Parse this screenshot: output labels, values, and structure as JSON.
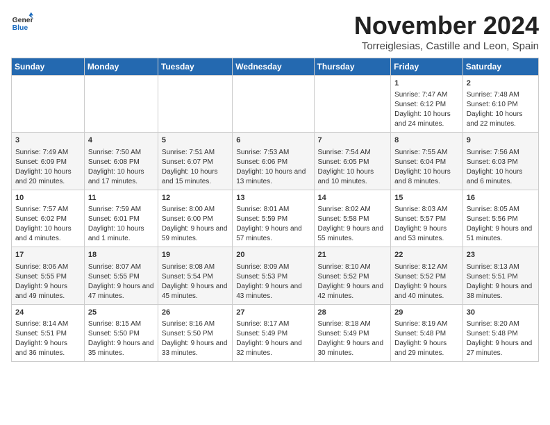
{
  "header": {
    "logo_line1": "General",
    "logo_line2": "Blue",
    "month": "November 2024",
    "location": "Torreiglesias, Castille and Leon, Spain"
  },
  "days_of_week": [
    "Sunday",
    "Monday",
    "Tuesday",
    "Wednesday",
    "Thursday",
    "Friday",
    "Saturday"
  ],
  "weeks": [
    [
      {
        "day": "",
        "data": ""
      },
      {
        "day": "",
        "data": ""
      },
      {
        "day": "",
        "data": ""
      },
      {
        "day": "",
        "data": ""
      },
      {
        "day": "",
        "data": ""
      },
      {
        "day": "1",
        "data": "Sunrise: 7:47 AM\nSunset: 6:12 PM\nDaylight: 10 hours and 24 minutes."
      },
      {
        "day": "2",
        "data": "Sunrise: 7:48 AM\nSunset: 6:10 PM\nDaylight: 10 hours and 22 minutes."
      }
    ],
    [
      {
        "day": "3",
        "data": "Sunrise: 7:49 AM\nSunset: 6:09 PM\nDaylight: 10 hours and 20 minutes."
      },
      {
        "day": "4",
        "data": "Sunrise: 7:50 AM\nSunset: 6:08 PM\nDaylight: 10 hours and 17 minutes."
      },
      {
        "day": "5",
        "data": "Sunrise: 7:51 AM\nSunset: 6:07 PM\nDaylight: 10 hours and 15 minutes."
      },
      {
        "day": "6",
        "data": "Sunrise: 7:53 AM\nSunset: 6:06 PM\nDaylight: 10 hours and 13 minutes."
      },
      {
        "day": "7",
        "data": "Sunrise: 7:54 AM\nSunset: 6:05 PM\nDaylight: 10 hours and 10 minutes."
      },
      {
        "day": "8",
        "data": "Sunrise: 7:55 AM\nSunset: 6:04 PM\nDaylight: 10 hours and 8 minutes."
      },
      {
        "day": "9",
        "data": "Sunrise: 7:56 AM\nSunset: 6:03 PM\nDaylight: 10 hours and 6 minutes."
      }
    ],
    [
      {
        "day": "10",
        "data": "Sunrise: 7:57 AM\nSunset: 6:02 PM\nDaylight: 10 hours and 4 minutes."
      },
      {
        "day": "11",
        "data": "Sunrise: 7:59 AM\nSunset: 6:01 PM\nDaylight: 10 hours and 1 minute."
      },
      {
        "day": "12",
        "data": "Sunrise: 8:00 AM\nSunset: 6:00 PM\nDaylight: 9 hours and 59 minutes."
      },
      {
        "day": "13",
        "data": "Sunrise: 8:01 AM\nSunset: 5:59 PM\nDaylight: 9 hours and 57 minutes."
      },
      {
        "day": "14",
        "data": "Sunrise: 8:02 AM\nSunset: 5:58 PM\nDaylight: 9 hours and 55 minutes."
      },
      {
        "day": "15",
        "data": "Sunrise: 8:03 AM\nSunset: 5:57 PM\nDaylight: 9 hours and 53 minutes."
      },
      {
        "day": "16",
        "data": "Sunrise: 8:05 AM\nSunset: 5:56 PM\nDaylight: 9 hours and 51 minutes."
      }
    ],
    [
      {
        "day": "17",
        "data": "Sunrise: 8:06 AM\nSunset: 5:55 PM\nDaylight: 9 hours and 49 minutes."
      },
      {
        "day": "18",
        "data": "Sunrise: 8:07 AM\nSunset: 5:55 PM\nDaylight: 9 hours and 47 minutes."
      },
      {
        "day": "19",
        "data": "Sunrise: 8:08 AM\nSunset: 5:54 PM\nDaylight: 9 hours and 45 minutes."
      },
      {
        "day": "20",
        "data": "Sunrise: 8:09 AM\nSunset: 5:53 PM\nDaylight: 9 hours and 43 minutes."
      },
      {
        "day": "21",
        "data": "Sunrise: 8:10 AM\nSunset: 5:52 PM\nDaylight: 9 hours and 42 minutes."
      },
      {
        "day": "22",
        "data": "Sunrise: 8:12 AM\nSunset: 5:52 PM\nDaylight: 9 hours and 40 minutes."
      },
      {
        "day": "23",
        "data": "Sunrise: 8:13 AM\nSunset: 5:51 PM\nDaylight: 9 hours and 38 minutes."
      }
    ],
    [
      {
        "day": "24",
        "data": "Sunrise: 8:14 AM\nSunset: 5:51 PM\nDaylight: 9 hours and 36 minutes."
      },
      {
        "day": "25",
        "data": "Sunrise: 8:15 AM\nSunset: 5:50 PM\nDaylight: 9 hours and 35 minutes."
      },
      {
        "day": "26",
        "data": "Sunrise: 8:16 AM\nSunset: 5:50 PM\nDaylight: 9 hours and 33 minutes."
      },
      {
        "day": "27",
        "data": "Sunrise: 8:17 AM\nSunset: 5:49 PM\nDaylight: 9 hours and 32 minutes."
      },
      {
        "day": "28",
        "data": "Sunrise: 8:18 AM\nSunset: 5:49 PM\nDaylight: 9 hours and 30 minutes."
      },
      {
        "day": "29",
        "data": "Sunrise: 8:19 AM\nSunset: 5:48 PM\nDaylight: 9 hours and 29 minutes."
      },
      {
        "day": "30",
        "data": "Sunrise: 8:20 AM\nSunset: 5:48 PM\nDaylight: 9 hours and 27 minutes."
      }
    ]
  ]
}
